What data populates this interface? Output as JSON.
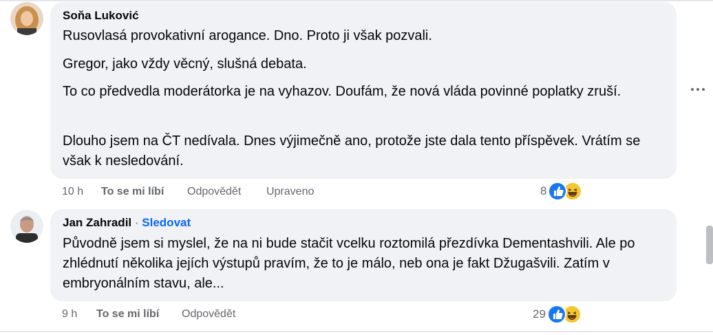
{
  "comments": [
    {
      "author": "Soňa Luković",
      "paragraphs": [
        "Rusovlasá provokativní arogance. Dno. Proto ji však pozvali.",
        "Gregor, jako vždy věcný, slušná debata.",
        "To co předvedla moderátorka je na vyhazov. Doufám, že nová vláda povinné poplatky zruší.",
        "Dlouho jsem na ČT nedívala. Dnes výjimečně ano, protože jste dala tento příspěvek. Vrátím se však k nesledování."
      ],
      "time": "10 h",
      "like_label": "To se mi líbí",
      "reply_label": "Odpovědět",
      "edited_label": "Upraveno",
      "reaction_count": "8",
      "reactions": [
        "like-icon",
        "haha-icon"
      ]
    },
    {
      "author": "Jan Zahradil",
      "separator": "·",
      "follow_label": "Sledovat",
      "paragraphs": [
        "Původně jsem si myslel, že na ni bude stačit vcelku roztomilá přezdívka Dementashvili. Ale po zhlédnutí několika jejích výstupů pravím, že to je málo, neb ona je fakt Džugašvili. Zatím v embryonálním stavu, ale..."
      ],
      "time": "9 h",
      "like_label": "To se mi líbí",
      "reply_label": "Odpovědět",
      "reaction_count": "29",
      "reactions": [
        "like-icon",
        "haha-icon"
      ]
    }
  ],
  "colors": {
    "bubble": "#f0f2f5",
    "meta_text": "#65676b",
    "link": "#0866ff",
    "like_reaction": "#1877f2",
    "haha_reaction": "#f7c62f"
  }
}
